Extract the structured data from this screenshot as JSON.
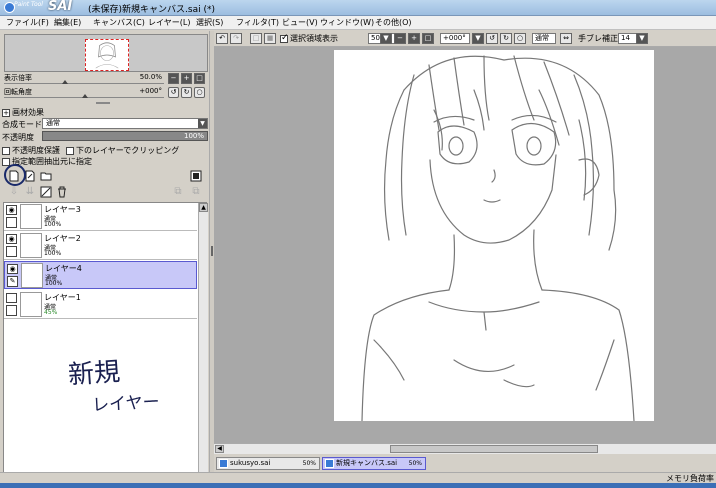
{
  "app": {
    "logo_small": "Paint Tool",
    "logo_big": "SAI",
    "title": "(未保存)新規キャンバス.sai (*)"
  },
  "menu": [
    "ファイル(F)",
    "編集(E)",
    "キャンバス(C)",
    "レイヤー(L)",
    "選択(S)",
    "フィルタ(T)",
    "ビュー(V)",
    "ウィンドウ(W)",
    "その他(O)"
  ],
  "navigator": {
    "zoom_label": "表示倍率",
    "zoom_value": "50.0%",
    "rotate_label": "回転角度",
    "rotate_value": "+000°"
  },
  "layer_panel": {
    "texture_effect": "画材効果",
    "blend_label": "合成モード",
    "blend_value": "通常",
    "opacity_label": "不透明度",
    "opacity_value": "100%",
    "preserve_opacity": "不透明度保護",
    "clip_lower": "下のレイヤーでクリッピング",
    "selection_source": "指定範囲抽出元に指定",
    "layers": [
      {
        "name": "レイヤー3",
        "mode": "通常",
        "opacity": "100%"
      },
      {
        "name": "レイヤー2",
        "mode": "通常",
        "opacity": "100%"
      },
      {
        "name": "レイヤー4",
        "mode": "通常",
        "opacity": "100%"
      },
      {
        "name": "レイヤー1",
        "mode": "通常",
        "opacity": "45%"
      }
    ],
    "handwritten_note_line1": "新規",
    "handwritten_note_line2": "レイヤー"
  },
  "canvas_toolbar": {
    "show_selection": "選択領域表示",
    "zoom": "50%",
    "angle": "+000°",
    "mode": "通常",
    "stabilizer_label": "手ブレ補正",
    "stabilizer_value": "14"
  },
  "tabs": [
    {
      "name": "sukusyo.sai",
      "zoom": "50%"
    },
    {
      "name": "新規キャンバス.sai",
      "zoom": "50%"
    }
  ],
  "status": {
    "memory": "メモリ負荷率"
  }
}
